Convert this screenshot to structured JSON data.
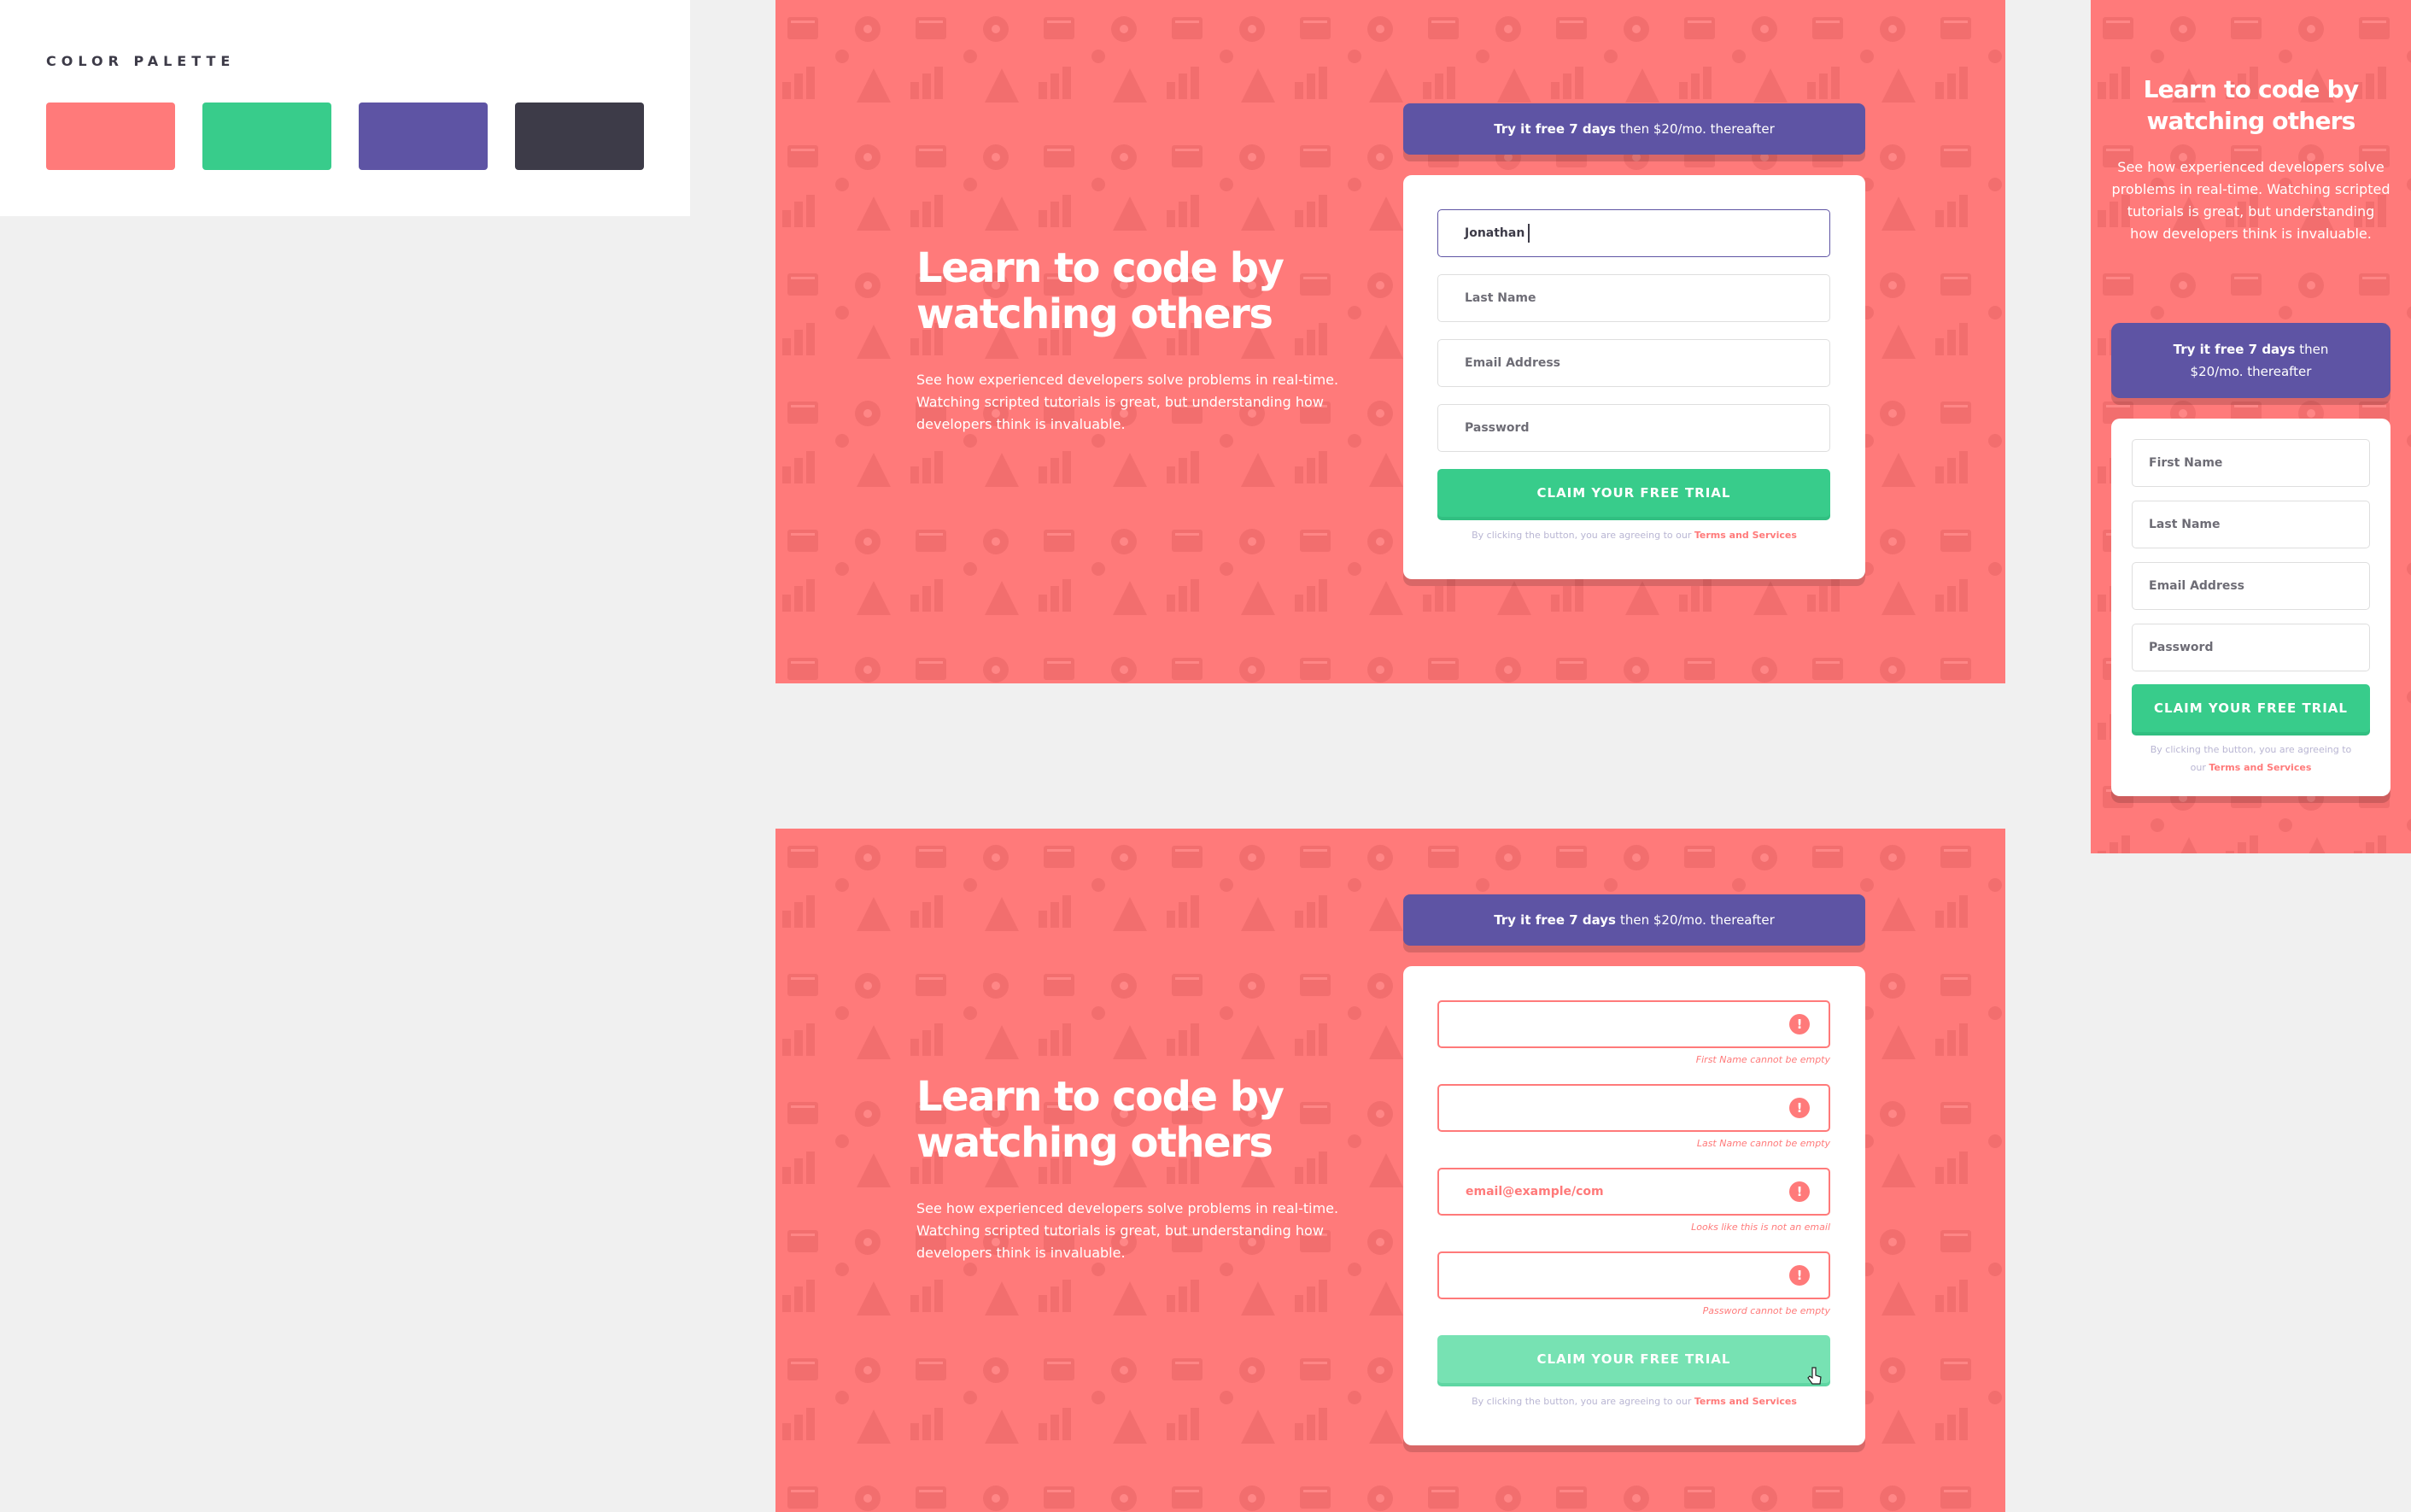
{
  "palette": {
    "title": "COLOR PALETTE",
    "swatches": [
      "#ff7a7a",
      "#38cc8b",
      "#5e54a4",
      "#3d3b48"
    ]
  },
  "colors": {
    "red": "#ff7a7a",
    "green": "#38cc8b",
    "blue": "#5e54a4",
    "dark": "#3d3b48"
  },
  "hero": {
    "title_line1": "Learn to code by",
    "title_line2": "watching others",
    "text_line1": "See how experienced developers solve problems in real-time.",
    "text_line2": "Watching scripted tutorials is great, but understanding how",
    "text_line3": "developers think is invaluable."
  },
  "banner": {
    "strong": "Try it free 7 days",
    "rest": "then $20/mo. thereafter"
  },
  "form_active": {
    "first_name_value": "Jonathan",
    "last_name_placeholder": "Last Name",
    "email_placeholder": "Email Address",
    "password_placeholder": "Password",
    "cta": "CLAIM YOUR FREE TRIAL",
    "terms_prefix": "By clicking the button, you are agreeing to our",
    "terms_link": "Terms and Services"
  },
  "form_error": {
    "first_name_error": "First Name cannot be empty",
    "last_name_error": "Last Name cannot be empty",
    "email_value": "email@example/com",
    "email_error": "Looks like this is not an email",
    "password_error": "Password cannot be empty",
    "error_icon": "!",
    "cta": "CLAIM YOUR FREE TRIAL",
    "terms_prefix": "By clicking the button, you are agreeing to our",
    "terms_link": "Terms and Services"
  },
  "mobile": {
    "title_line1": "Learn to code by",
    "title_line2": "watching others",
    "text": "See how experienced developers solve problems in real-time. Watching scripted tutorials is great, but understanding how developers think is invaluable.",
    "banner_strong": "Try it free 7 days",
    "banner_rest1": "then",
    "banner_rest2": "$20/mo. thereafter",
    "first_name_placeholder": "First Name",
    "last_name_placeholder": "Last Name",
    "email_placeholder": "Email Address",
    "password_placeholder": "Password",
    "cta": "CLAIM YOUR FREE TRIAL",
    "terms_prefix": "By clicking the button, you are agreeing to our",
    "terms_link": "Terms and Services"
  },
  "icons": [
    "alert-icon",
    "pointer-cursor-icon",
    "background-pattern-icons"
  ]
}
